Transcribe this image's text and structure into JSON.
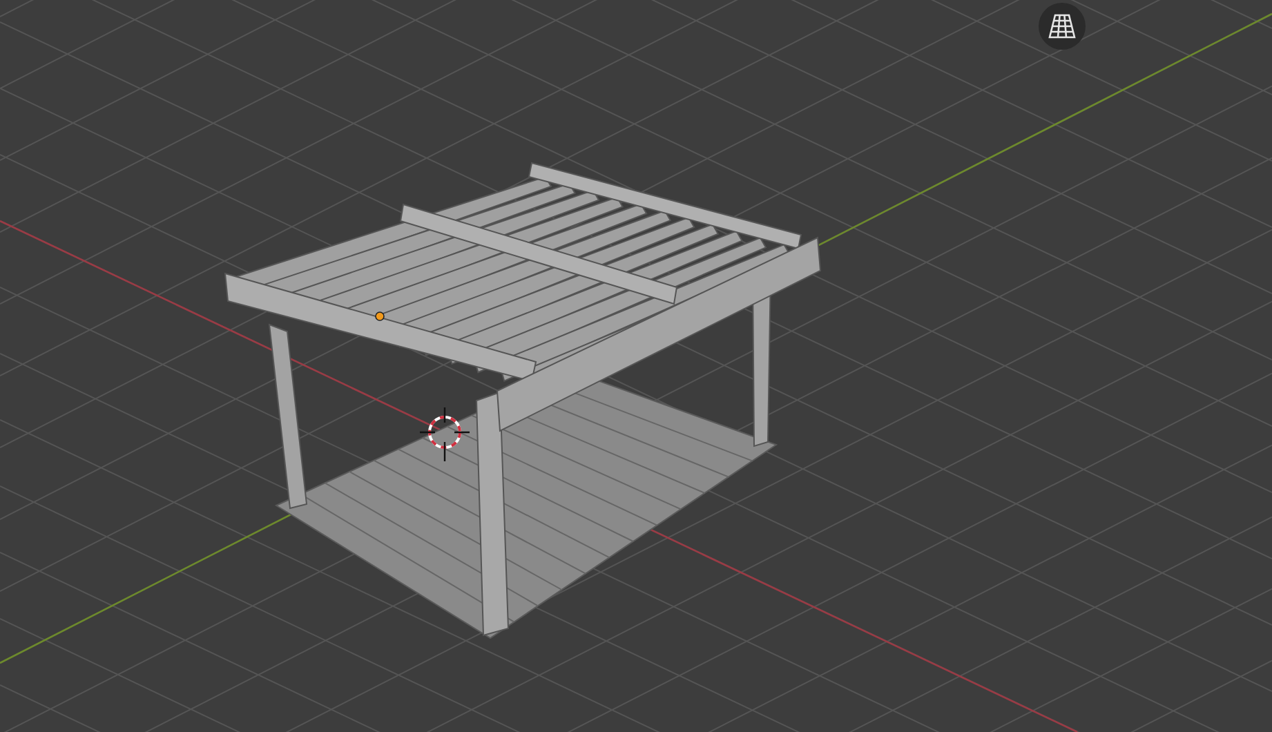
{
  "viewport": {
    "grid_visible": true,
    "axes_visible": true
  },
  "object_origin": {
    "selected": true
  },
  "overlay_button": {
    "on": false
  }
}
